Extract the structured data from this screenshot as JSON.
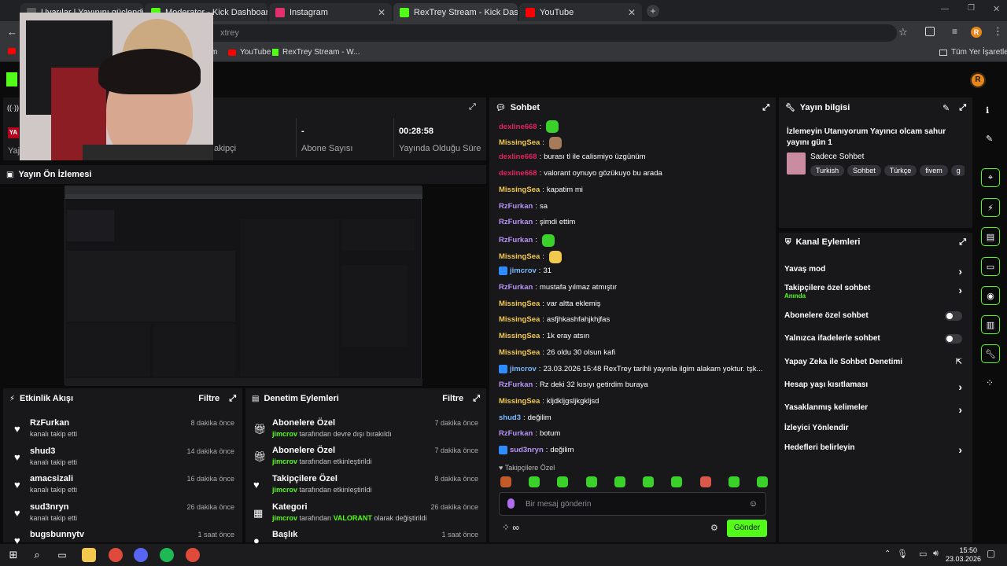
{
  "browser": {
    "tabs": [
      {
        "label": "Uyarılar | Yayınını güçlendirme",
        "color": "#5a5a5a"
      },
      {
        "label": "Moderator - Kick Dashboard",
        "color": "#53fc18"
      },
      {
        "label": "Instagram",
        "color": "#e1306c"
      },
      {
        "label": "RexTrey Stream - Kick Dashboa",
        "color": "#53fc18"
      },
      {
        "label": "YouTube",
        "color": "#ff0000"
      }
    ],
    "tab_close": "✕",
    "new_tab": "+",
    "address_fragment": "xtrey",
    "bookmarks": [
      {
        "label": "m",
        "color": "#ff0000"
      },
      {
        "label": "YouTube",
        "color": "#ff0000"
      },
      {
        "label": "RexTrey Stream - W...",
        "color": "#53fc18"
      }
    ],
    "all_bookmarks": "Tüm Yer İşaretleri",
    "profile_initial": "R"
  },
  "stats": {
    "followers_label": "akipçi",
    "subscribers_value": "-",
    "subscribers_label": "Abone Sayısı",
    "uptime_value": "00:28:58",
    "uptime_label": "Yayında Olduğu Süre",
    "left_fragment": "Yaj",
    "badge": "YA"
  },
  "preview": {
    "title": "Yayın Ön İzlemesi"
  },
  "activity": {
    "title": "Etkinlik Akışı",
    "filter": "Filtre",
    "items": [
      {
        "user": "RzFurkan",
        "text": "kanalı takip etti",
        "time": "8 dakika önce"
      },
      {
        "user": "shud3",
        "text": "kanalı takip etti",
        "time": "14 dakika önce"
      },
      {
        "user": "amacsizali",
        "text": "kanalı takip etti",
        "time": "16 dakika önce"
      },
      {
        "user": "sud3nryn",
        "text": "kanalı takip etti",
        "time": "26 dakika önce"
      },
      {
        "user": "bugsbunnytv",
        "text": "",
        "time": "1 saat önce"
      }
    ]
  },
  "moderation": {
    "title": "Denetim Eylemleri",
    "filter": "Filtre",
    "items": [
      {
        "title": "Abonelere Özel",
        "actor": "jimcrov",
        "rest": "tarafından devre dışı bırakıldı",
        "extra": "",
        "suffix": "",
        "time": "7 dakika önce"
      },
      {
        "title": "Abonelere Özel",
        "actor": "jimcrov",
        "rest": "tarafından etkinleştirildi",
        "extra": "",
        "suffix": "",
        "time": "7 dakika önce"
      },
      {
        "title": "Takipçilere Özel",
        "actor": "jimcrov",
        "rest": "tarafından etkinleştirildi",
        "extra": "",
        "suffix": "",
        "time": "8 dakika önce"
      },
      {
        "title": "Kategori",
        "actor": "jimcrov",
        "rest": "tarafından",
        "extra": "VALORANT",
        "suffix": "olarak değiştirildi",
        "time": "26 dakika önce"
      },
      {
        "title": "Başlık",
        "actor": "",
        "rest": "",
        "extra": "",
        "suffix": "",
        "time": "1 saat önce"
      }
    ]
  },
  "chat": {
    "title": "Sohbet",
    "messages": [
      {
        "user": "dexline668",
        "color": "#e0245e",
        "text": "",
        "emote": "#3ad12b"
      },
      {
        "user": "MissingSea",
        "color": "#f2c94c",
        "text": "",
        "emote": "#a77a5a"
      },
      {
        "user": "dexline668",
        "color": "#e0245e",
        "text": "burası tl ile calismiyo üzgünüm",
        "emote": ""
      },
      {
        "user": "dexline668",
        "color": "#e0245e",
        "text": "valorant oynuyo gözükuyo bu arada",
        "emote": ""
      },
      {
        "user": "MissingSea",
        "color": "#f2c94c",
        "text": "kapatim mi",
        "emote": ""
      },
      {
        "user": "RzFurkan",
        "color": "#b794f6",
        "text": "sa",
        "emote": ""
      },
      {
        "user": "RzFurkan",
        "color": "#b794f6",
        "text": "şimdi ettim",
        "emote": ""
      },
      {
        "user": "RzFurkan",
        "color": "#b794f6",
        "text": "",
        "emote": "#3ad12b"
      },
      {
        "user": "MissingSea",
        "color": "#f2c94c",
        "text": "",
        "emote": "#f2c94c"
      },
      {
        "user": "jimcrov",
        "color": "#7ab8ff",
        "text": "31",
        "emote": ""
      },
      {
        "user": "RzFurkan",
        "color": "#b794f6",
        "text": "mustafa yılmaz atmıştır",
        "emote": ""
      },
      {
        "user": "MissingSea",
        "color": "#f2c94c",
        "text": "var altta eklemiş",
        "emote": ""
      },
      {
        "user": "MissingSea",
        "color": "#f2c94c",
        "text": "asfjhkashfahjkhjfas",
        "emote": ""
      },
      {
        "user": "MissingSea",
        "color": "#f2c94c",
        "text": "1k eray atsın",
        "emote": ""
      },
      {
        "user": "MissingSea",
        "color": "#f2c94c",
        "text": "26 oldu 30 olsun kafi",
        "emote": ""
      },
      {
        "user": "jimcrov",
        "color": "#7ab8ff",
        "text": "23.03.2026 15:48 RexTrey tarihli yayınla ilgim alakam yoktur. tşk...",
        "emote": ""
      },
      {
        "user": "RzFurkan",
        "color": "#b794f6",
        "text": "Rz deki 32 kısıyı getirdim buraya",
        "emote": ""
      },
      {
        "user": "MissingSea",
        "color": "#f2c94c",
        "text": "kljdkljgsljkgkljsd",
        "emote": ""
      },
      {
        "user": "shud3",
        "color": "#7ab8ff",
        "text": "değilim",
        "emote": ""
      },
      {
        "user": "RzFurkan",
        "color": "#b794f6",
        "text": "botum",
        "emote": ""
      },
      {
        "user": "sud3nryn",
        "color": "#b794f6",
        "text": "değilim",
        "emote": ""
      }
    ],
    "followers_only": "Takipçilere Özel",
    "placeholder": "Bir mesaj gönderin",
    "send": "Gönder",
    "infinity": "∞"
  },
  "stream_info": {
    "title": "Yayın bilgisi",
    "stream_title": "İzlemeyin Utanıyorum Yayıncı olcam sahur yayını gün 1",
    "category": "Sadece Sohbet",
    "tags": [
      "Turkish",
      "Sohbet",
      "Türkçe",
      "fivem",
      "g"
    ]
  },
  "channel_actions": {
    "title": "Kanal Eylemleri",
    "items": [
      {
        "label": "Yavaş mod",
        "sub": "",
        "control": "chevron"
      },
      {
        "label": "Takipçilere özel sohbet",
        "sub": "Anında",
        "control": "chevron"
      },
      {
        "label": "Abonelere özel sohbet",
        "sub": "",
        "control": "toggle"
      },
      {
        "label": "Yalnızca ifadelerle sohbet",
        "sub": "",
        "control": "toggle"
      },
      {
        "label": "Yapay Zeka ile Sohbet Denetimi",
        "sub": "",
        "control": "external"
      },
      {
        "label": "Hesap yaşı kısıtlaması",
        "sub": "",
        "control": "chevron"
      },
      {
        "label": "Yasaklanmış kelimeler",
        "sub": "",
        "control": "chevron"
      },
      {
        "label": "İzleyici Yönlendir",
        "sub": "",
        "control": "none"
      },
      {
        "label": "Hedefleri belirleyin",
        "sub": "",
        "control": "chevron"
      }
    ]
  },
  "taskbar": {
    "time": "15:50",
    "date": "23.03.2026"
  },
  "colors": {
    "kick_green": "#53fc18",
    "panel": "#18181b",
    "bg": "#0b0b0c"
  }
}
